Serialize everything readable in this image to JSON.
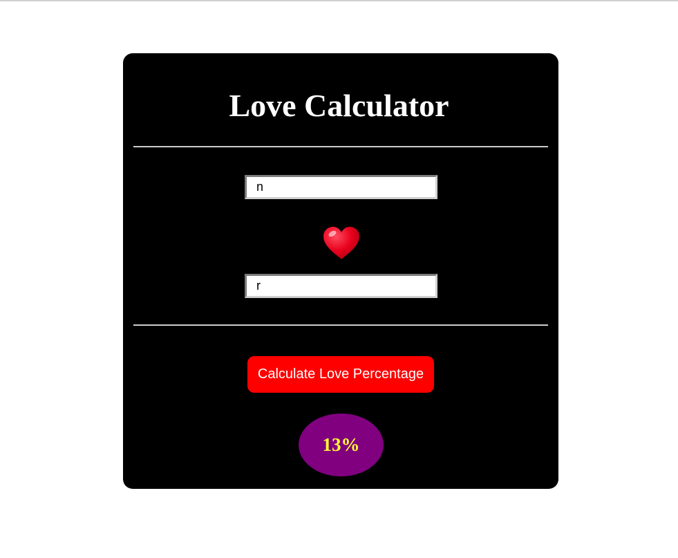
{
  "app": {
    "title": "Love Calculator"
  },
  "form": {
    "name1_value": "n",
    "name2_value": "r",
    "heart_icon": "heart-icon"
  },
  "action": {
    "button_label": "Calculate Love Percentage"
  },
  "result": {
    "percentage_text": "13%"
  },
  "colors": {
    "page_background": "#ffffff",
    "card_background": "#000000",
    "button_background": "#ff0000",
    "result_background": "#800080",
    "result_text": "#ffff33",
    "heart": "#e8001c"
  }
}
